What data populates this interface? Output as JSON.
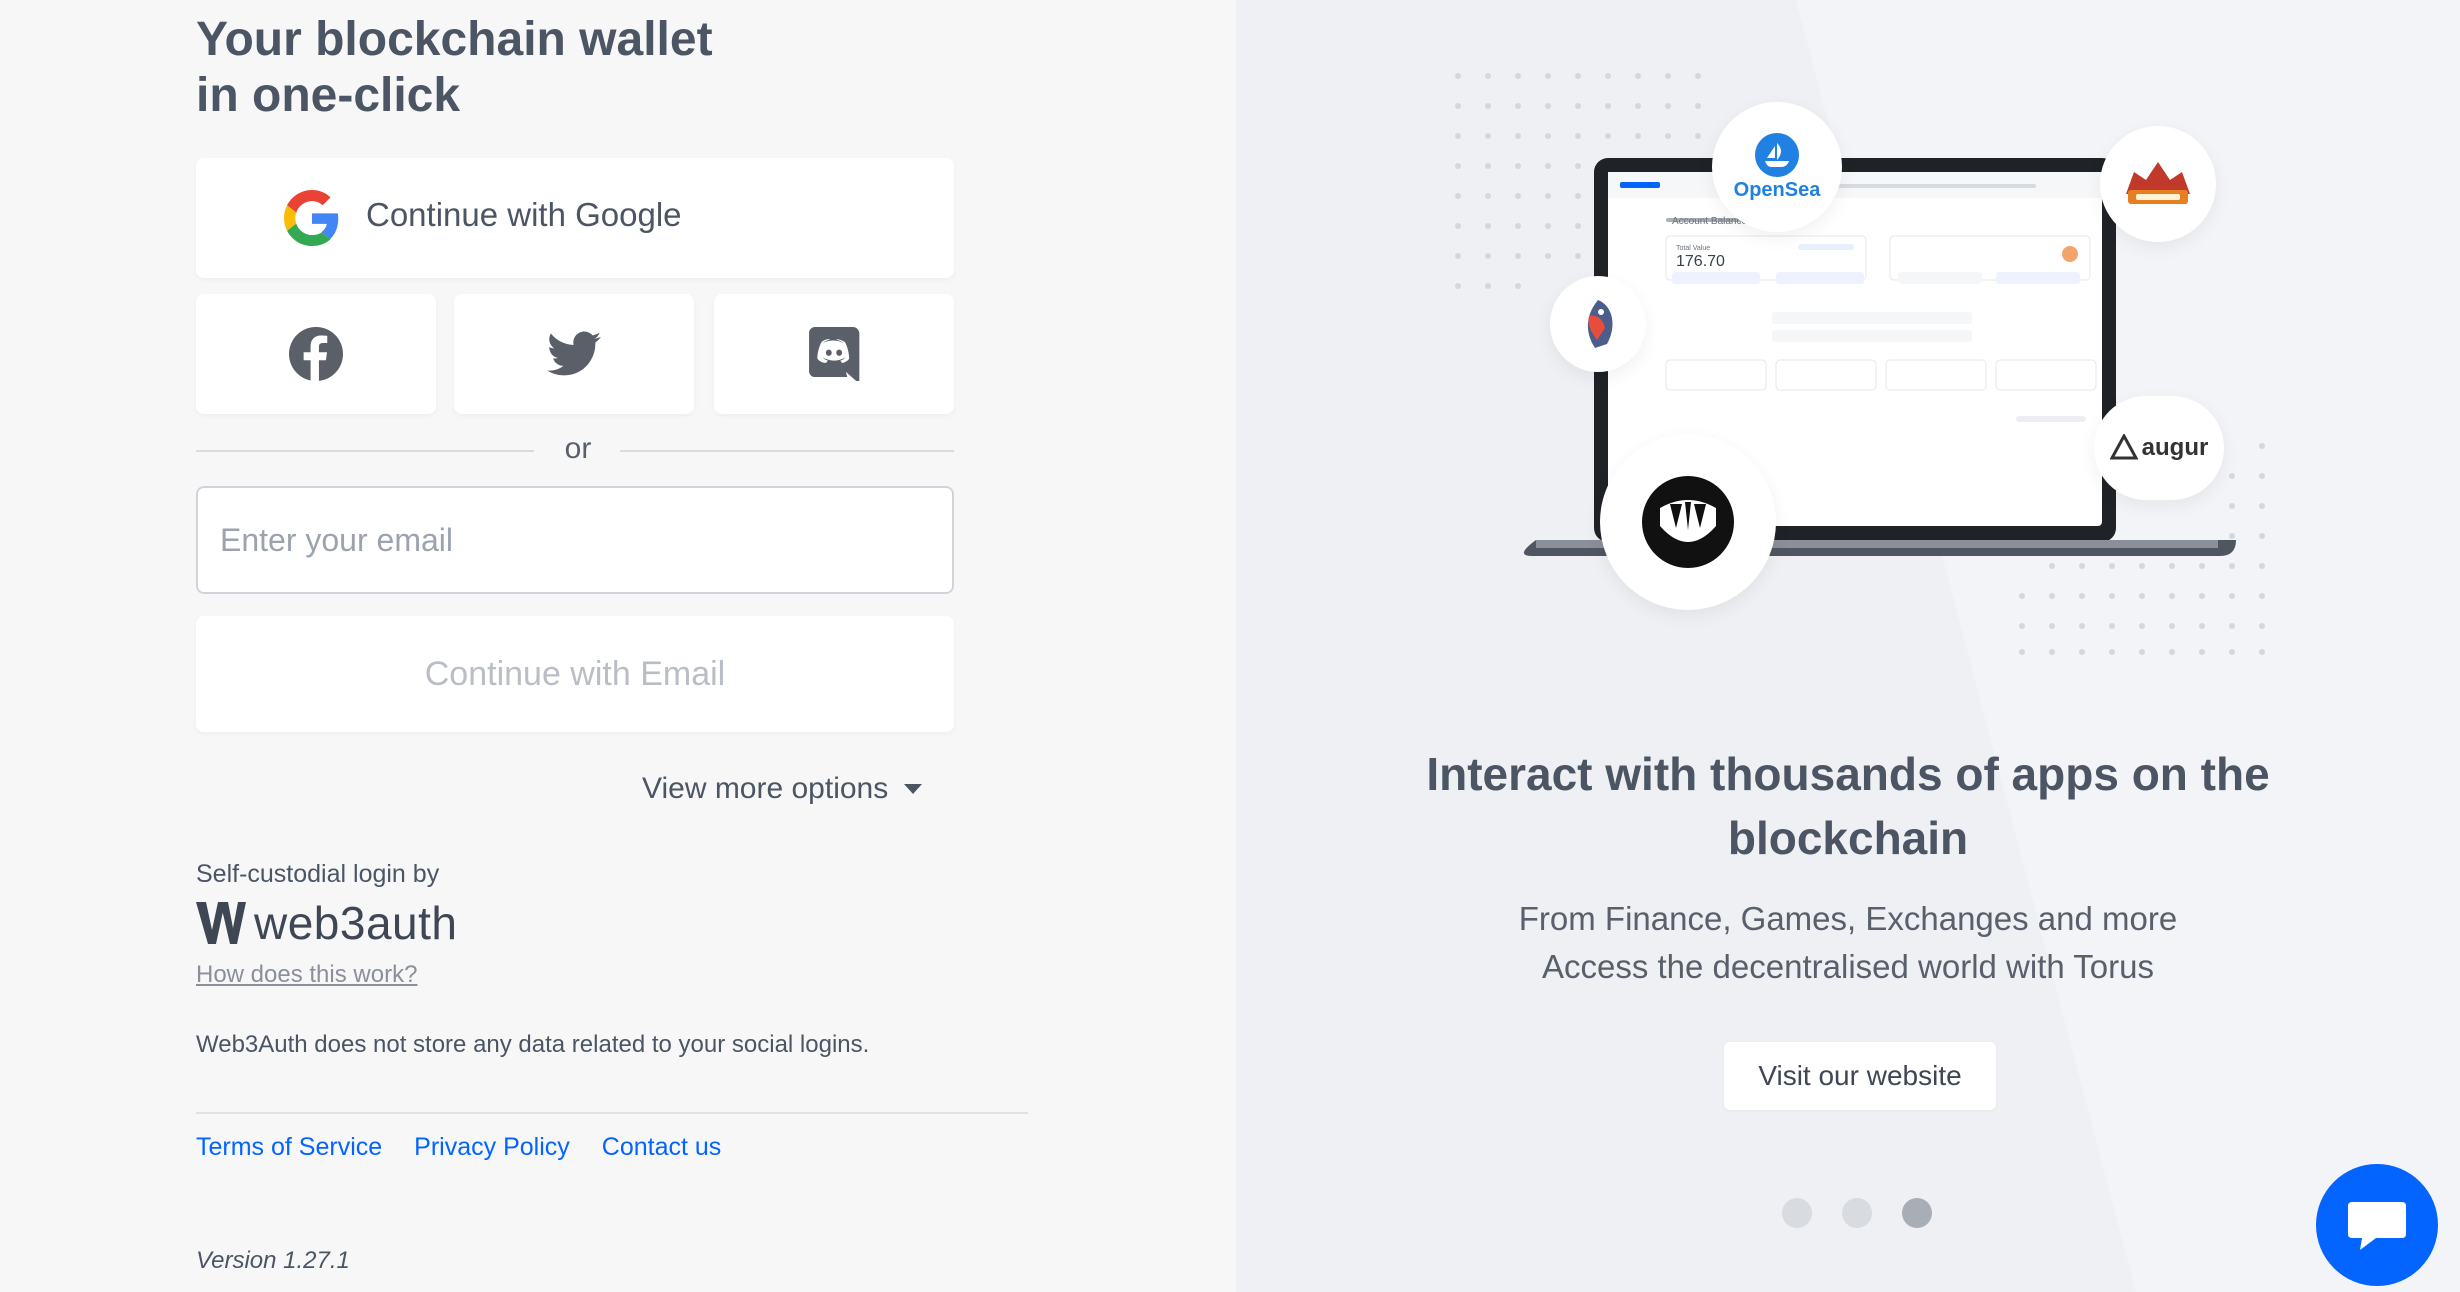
{
  "left": {
    "title": "Your blockchain wallet\nin one-click",
    "google_button": "Continue with Google",
    "social": [
      {
        "name": "facebook",
        "icon": "facebook-icon"
      },
      {
        "name": "twitter",
        "icon": "twitter-icon"
      },
      {
        "name": "discord",
        "icon": "discord-icon"
      }
    ],
    "or_text": "or",
    "email_placeholder": "Enter your email",
    "email_value": "",
    "email_button": "Continue with Email",
    "more_options": "View more options",
    "self_custodial": "Self-custodial login by",
    "brand": "web3auth",
    "how_link": "How does this work?",
    "no_store": "Web3Auth does not store any data related to your social logins.",
    "footer_links": {
      "terms": "Terms of Service",
      "privacy": "Privacy Policy",
      "contact": "Contact us"
    },
    "version": "Version 1.27.1"
  },
  "right": {
    "badges": {
      "opensea": "OpenSea",
      "augur": "augur"
    },
    "screen": {
      "section_title": "Account Balance",
      "total_label": "Total Value",
      "total_value": "176.70"
    },
    "heading": "Interact with thousands of apps on the blockchain",
    "subline1": "From Finance, Games, Exchanges and more",
    "subline2": "Access the decentralised world with Torus",
    "visit_button": "Visit our website",
    "carousel": {
      "count": 3,
      "active_index": 2
    }
  },
  "colors": {
    "accent": "#0364ff",
    "text": "#4b5563",
    "panel_left": "#f7f7f8",
    "panel_right": "#eef0f4"
  }
}
